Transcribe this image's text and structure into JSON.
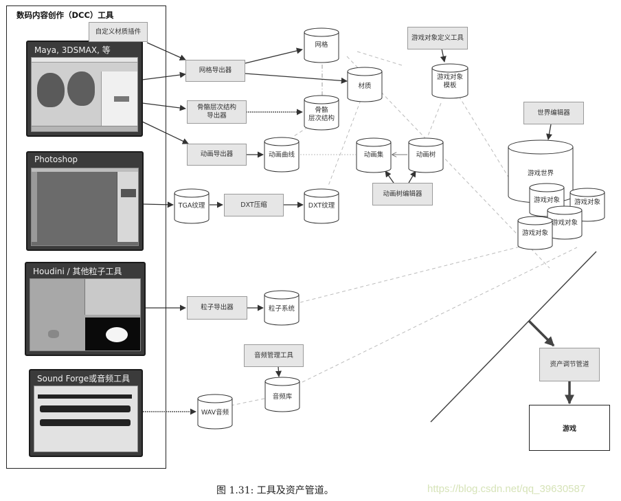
{
  "dcc_group": {
    "title": "数码内容创作（DCC）工具",
    "tools": [
      {
        "id": "maya",
        "label": "Maya, 3DSMAX, 等"
      },
      {
        "id": "photoshop",
        "label": "Photoshop"
      },
      {
        "id": "houdini",
        "label": "Houdini / 其他粒子工具"
      },
      {
        "id": "soundforge",
        "label": "Sound Forge或音频工具"
      }
    ]
  },
  "processes": {
    "custom_material_plugin": "自定义材质插件",
    "mesh_exporter": "网格导出器",
    "skeleton_exporter": "骨骼层次结构\n导出器",
    "anim_exporter": "动画导出器",
    "dxt_compress": "DXT压缩",
    "particle_exporter": "粒子导出器",
    "audio_manager": "音频管理工具",
    "game_object_def_tool": "游戏对象定义工具",
    "anim_tree_editor": "动画树编辑器",
    "world_editor": "世界编辑器",
    "asset_conditioning": "资产调节管道"
  },
  "stores": {
    "mesh": "网格",
    "material": "材质",
    "skeleton": "骨骼\n层次结构",
    "anim_curve": "动画曲线",
    "tga_texture": "TGA纹理",
    "dxt_texture": "DXT纹理",
    "anim_set": "动画集",
    "anim_tree": "动画树",
    "game_object_template": "游戏对象\n模板",
    "game_world": "游戏世界",
    "game_object": "游戏对象",
    "particle_system": "粒子系统",
    "audio_library": "音频库",
    "wav_audio": "WAV音频"
  },
  "game": {
    "label": "游戏"
  },
  "caption": "图 1.31: 工具及资产管道。",
  "watermark": "https://blog.csdn.net/qq_39630587"
}
